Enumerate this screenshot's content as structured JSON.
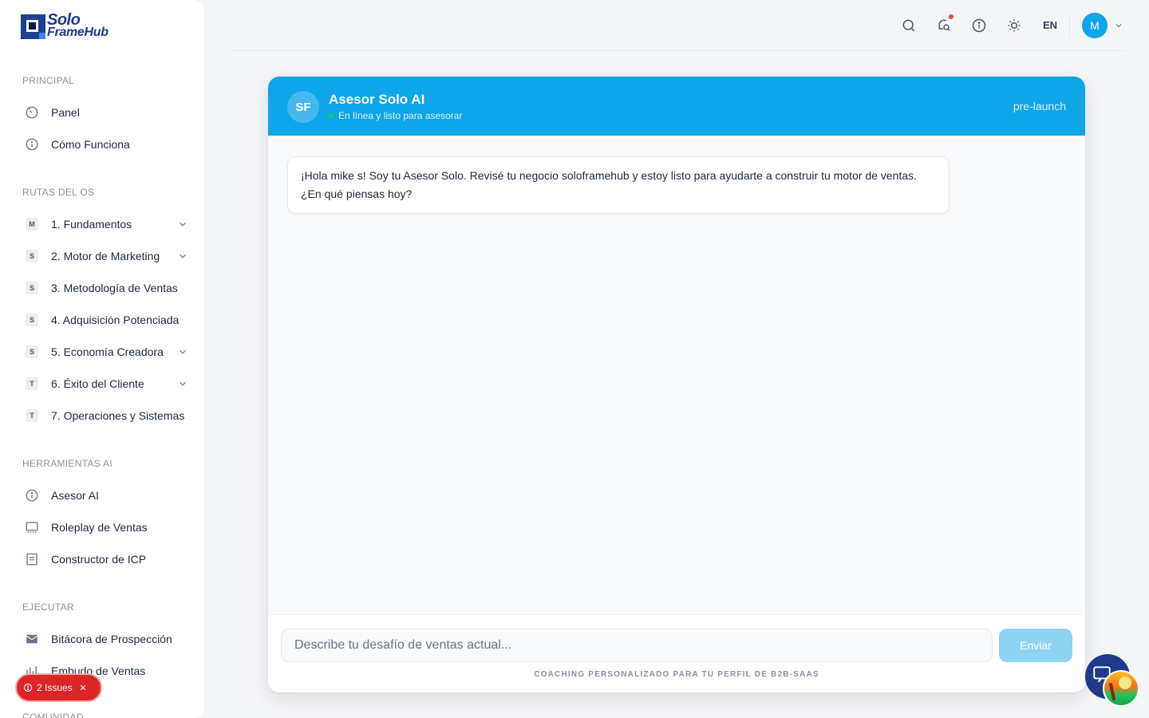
{
  "brand": {
    "line1": "Solo",
    "line2": "FrameHub"
  },
  "sidebar": {
    "sections": {
      "principal": "PRINCIPAL",
      "rutas": "RUTAS DEL OS",
      "herramientas": "HERRAMIENTAS AI",
      "ejecutar": "EJECUTAR",
      "comunidad": "COMUNIDAD"
    },
    "principal": [
      {
        "label": "Panel",
        "icon": "gauge-icon"
      },
      {
        "label": "Cómo Funciona",
        "icon": "info-icon"
      }
    ],
    "rutas": [
      {
        "badge": "M",
        "label": "1. Fundamentos",
        "expandable": true
      },
      {
        "badge": "S",
        "label": "2. Motor de Marketing",
        "expandable": true
      },
      {
        "badge": "S",
        "label": "3. Metodología de Ventas",
        "expandable": true
      },
      {
        "badge": "S",
        "label": "4. Adquisición Potenciada",
        "expandable": true
      },
      {
        "badge": "S",
        "label": "5. Economía Creadora",
        "expandable": true
      },
      {
        "badge": "T",
        "label": "6. Éxito del Cliente",
        "expandable": true
      },
      {
        "badge": "T",
        "label": "7. Operaciones y Sistemas",
        "expandable": true
      }
    ],
    "herramientas": [
      {
        "label": "Asesor AI",
        "icon": "info-icon"
      },
      {
        "label": "Roleplay de Ventas",
        "icon": "monitor-icon"
      },
      {
        "label": "Constructor de ICP",
        "icon": "document-icon"
      }
    ],
    "ejecutar": [
      {
        "label": "Bitácora de Prospección",
        "icon": "mail-icon"
      },
      {
        "label": "Embudo de Ventas",
        "icon": "bar-chart-icon"
      }
    ]
  },
  "topbar": {
    "language": "EN",
    "avatar_initial": "M"
  },
  "chat": {
    "avatar_initials": "SF",
    "title": "Asesor Solo AI",
    "status": "En línea y listo para asesorar",
    "stage": "pre-launch",
    "messages": [
      {
        "from": "assistant",
        "text": "¡Hola mike s! Soy tu Asesor Solo. Revisé tu negocio soloframehub y estoy listo para ayudarte a construir tu motor de ventas. ¿En qué piensas hoy?"
      }
    ],
    "input_placeholder": "Describe tu desafío de ventas actual...",
    "send_label": "Enviar",
    "footnote": "COACHING PERSONALIZADO PARA TU PERFIL DE B2B-SAAS"
  },
  "issues": {
    "label": "2 Issues"
  },
  "colors": {
    "accent": "#0ea5e9",
    "brand": "#1e3a8a",
    "danger": "#dc2626",
    "online": "#22c55e"
  }
}
